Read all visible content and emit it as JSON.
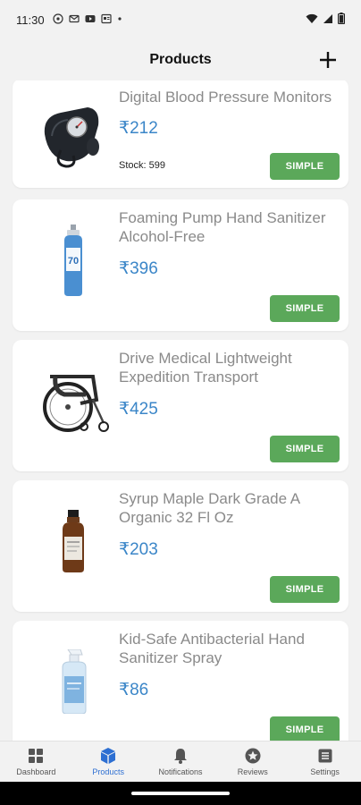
{
  "status_bar": {
    "time": "11:30",
    "icons": [
      "whatsapp-icon",
      "gmail-icon",
      "youtube-icon",
      "news-icon",
      "dot-icon",
      "wifi-icon",
      "signal-icon",
      "battery-icon"
    ]
  },
  "header": {
    "title": "Products",
    "add_icon": "plus-icon"
  },
  "products": [
    {
      "name": "Digital Blood Pressure Monitors",
      "price": "₹212",
      "stock": "Stock: 599",
      "type": "SIMPLE",
      "image": "blood-pressure-monitor"
    },
    {
      "name": "Foaming Pump Hand Sanitizer Alcohol-Free",
      "price": "₹396",
      "stock": "",
      "type": "SIMPLE",
      "image": "sanitizer-bottle"
    },
    {
      "name": "Drive Medical Lightweight Expedition Transport",
      "price": "₹425",
      "stock": "",
      "type": "SIMPLE",
      "image": "wheelchair"
    },
    {
      "name": "Syrup Maple Dark Grade A Organic 32 Fl Oz",
      "price": "₹203",
      "stock": "",
      "type": "SIMPLE",
      "image": "syrup-bottle"
    },
    {
      "name": "Kid-Safe Antibacterial Hand Sanitizer Spray",
      "price": "₹86",
      "stock": "",
      "type": "SIMPLE",
      "image": "spray-bottle"
    }
  ],
  "bottom_nav": {
    "items": [
      {
        "label": "Dashboard",
        "icon": "dashboard-icon"
      },
      {
        "label": "Products",
        "icon": "cube-icon",
        "active": true
      },
      {
        "label": "Notifications",
        "icon": "bell-icon"
      },
      {
        "label": "Reviews",
        "icon": "star-badge-icon"
      },
      {
        "label": "Settings",
        "icon": "settings-list-icon"
      }
    ]
  },
  "colors": {
    "accent_blue": "#2d6fd2",
    "price_blue": "#3b86c8",
    "button_green": "#5ba85a",
    "background": "#f2f2f2"
  }
}
